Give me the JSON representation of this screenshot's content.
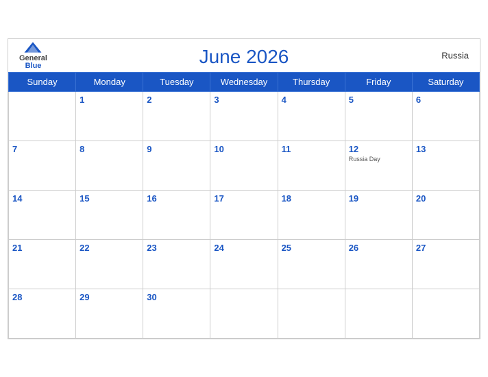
{
  "header": {
    "title": "June 2026",
    "country": "Russia",
    "logo_general": "General",
    "logo_blue": "Blue"
  },
  "days_of_week": [
    "Sunday",
    "Monday",
    "Tuesday",
    "Wednesday",
    "Thursday",
    "Friday",
    "Saturday"
  ],
  "weeks": [
    [
      {
        "day": "",
        "holiday": ""
      },
      {
        "day": "1",
        "holiday": ""
      },
      {
        "day": "2",
        "holiday": ""
      },
      {
        "day": "3",
        "holiday": ""
      },
      {
        "day": "4",
        "holiday": ""
      },
      {
        "day": "5",
        "holiday": ""
      },
      {
        "day": "6",
        "holiday": ""
      }
    ],
    [
      {
        "day": "7",
        "holiday": ""
      },
      {
        "day": "8",
        "holiday": ""
      },
      {
        "day": "9",
        "holiday": ""
      },
      {
        "day": "10",
        "holiday": ""
      },
      {
        "day": "11",
        "holiday": ""
      },
      {
        "day": "12",
        "holiday": "Russia Day"
      },
      {
        "day": "13",
        "holiday": ""
      }
    ],
    [
      {
        "day": "14",
        "holiday": ""
      },
      {
        "day": "15",
        "holiday": ""
      },
      {
        "day": "16",
        "holiday": ""
      },
      {
        "day": "17",
        "holiday": ""
      },
      {
        "day": "18",
        "holiday": ""
      },
      {
        "day": "19",
        "holiday": ""
      },
      {
        "day": "20",
        "holiday": ""
      }
    ],
    [
      {
        "day": "21",
        "holiday": ""
      },
      {
        "day": "22",
        "holiday": ""
      },
      {
        "day": "23",
        "holiday": ""
      },
      {
        "day": "24",
        "holiday": ""
      },
      {
        "day": "25",
        "holiday": ""
      },
      {
        "day": "26",
        "holiday": ""
      },
      {
        "day": "27",
        "holiday": ""
      }
    ],
    [
      {
        "day": "28",
        "holiday": ""
      },
      {
        "day": "29",
        "holiday": ""
      },
      {
        "day": "30",
        "holiday": ""
      },
      {
        "day": "",
        "holiday": ""
      },
      {
        "day": "",
        "holiday": ""
      },
      {
        "day": "",
        "holiday": ""
      },
      {
        "day": "",
        "holiday": ""
      }
    ]
  ]
}
